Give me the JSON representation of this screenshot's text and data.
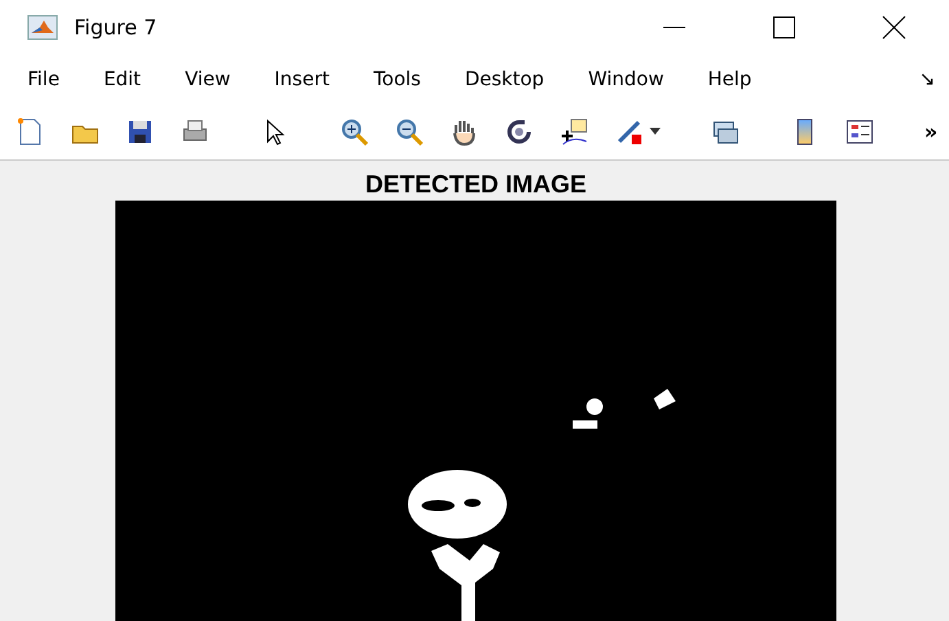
{
  "window": {
    "title": "Figure 7"
  },
  "menu": {
    "items": [
      {
        "label": "File"
      },
      {
        "label": "Edit"
      },
      {
        "label": "View"
      },
      {
        "label": "Insert"
      },
      {
        "label": "Tools"
      },
      {
        "label": "Desktop"
      },
      {
        "label": "Window"
      },
      {
        "label": "Help"
      }
    ],
    "dock_arrow": "↘"
  },
  "toolbar": {
    "overflow": "»"
  },
  "figure": {
    "title": "DETECTED IMAGE"
  }
}
